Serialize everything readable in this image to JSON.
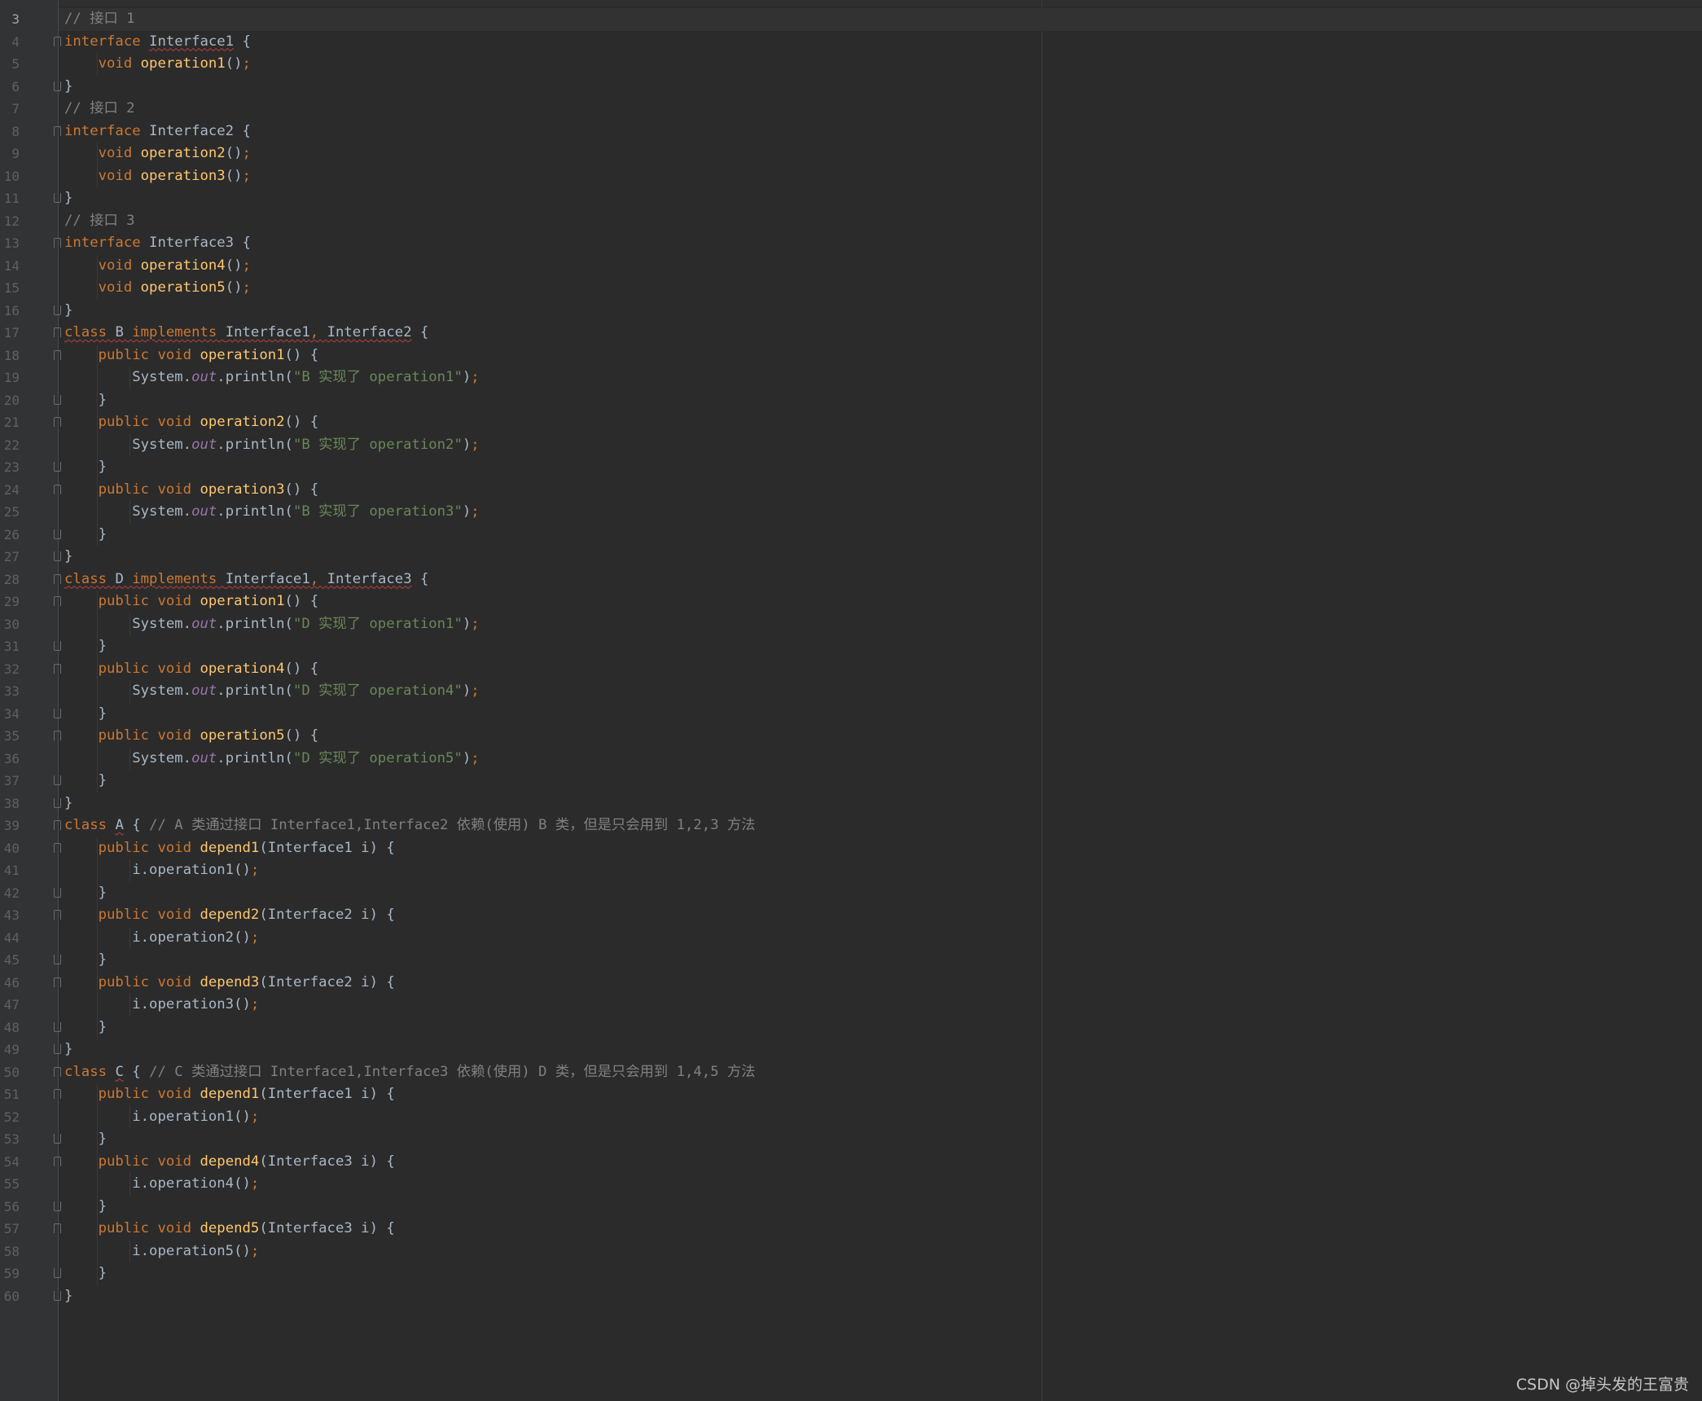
{
  "editor": {
    "language": "java",
    "current_line": "3",
    "colors": {
      "background": "#2b2b2b",
      "keyword": "#cc7832",
      "function": "#ffc66d",
      "comment": "#808080",
      "string": "#6a8759",
      "field": "#9876aa",
      "text": "#a9b7c6"
    },
    "lines": [
      {
        "n": "3",
        "fold": "",
        "indent": 0,
        "tokens": [
          [
            "cm",
            "// 接口 1"
          ]
        ]
      },
      {
        "n": "4",
        "fold": "open",
        "indent": 0,
        "tokens": [
          [
            "kw",
            "interface "
          ],
          [
            "wv",
            "Interface1"
          ],
          [
            "",
            " {"
          ]
        ]
      },
      {
        "n": "5",
        "fold": "",
        "indent": 1,
        "tokens": [
          [
            "kw",
            "void "
          ],
          [
            "fn",
            "operation1"
          ],
          [
            "",
            "()"
          ],
          [
            "kw",
            ";"
          ]
        ]
      },
      {
        "n": "6",
        "fold": "close",
        "indent": 0,
        "tokens": [
          [
            "",
            "}"
          ]
        ]
      },
      {
        "n": "7",
        "fold": "",
        "indent": 0,
        "tokens": [
          [
            "cm",
            "// 接口 2"
          ]
        ]
      },
      {
        "n": "8",
        "fold": "open",
        "indent": 0,
        "tokens": [
          [
            "kw",
            "interface "
          ],
          [
            "",
            "Interface2 {"
          ]
        ]
      },
      {
        "n": "9",
        "fold": "",
        "indent": 1,
        "tokens": [
          [
            "kw",
            "void "
          ],
          [
            "fn",
            "operation2"
          ],
          [
            "",
            "()"
          ],
          [
            "kw",
            ";"
          ]
        ]
      },
      {
        "n": "10",
        "fold": "",
        "indent": 1,
        "tokens": [
          [
            "kw",
            "void "
          ],
          [
            "fn",
            "operation3"
          ],
          [
            "",
            "()"
          ],
          [
            "kw",
            ";"
          ]
        ]
      },
      {
        "n": "11",
        "fold": "close",
        "indent": 0,
        "tokens": [
          [
            "",
            "}"
          ]
        ]
      },
      {
        "n": "12",
        "fold": "",
        "indent": 0,
        "tokens": [
          [
            "cm",
            "// 接口 3"
          ]
        ]
      },
      {
        "n": "13",
        "fold": "open",
        "indent": 0,
        "tokens": [
          [
            "kw",
            "interface "
          ],
          [
            "",
            "Interface3 {"
          ]
        ]
      },
      {
        "n": "14",
        "fold": "",
        "indent": 1,
        "tokens": [
          [
            "kw",
            "void "
          ],
          [
            "fn",
            "operation4"
          ],
          [
            "",
            "()"
          ],
          [
            "kw",
            ";"
          ]
        ]
      },
      {
        "n": "15",
        "fold": "",
        "indent": 1,
        "tokens": [
          [
            "kw",
            "void "
          ],
          [
            "fn",
            "operation5"
          ],
          [
            "",
            "()"
          ],
          [
            "kw",
            ";"
          ]
        ]
      },
      {
        "n": "16",
        "fold": "close",
        "indent": 0,
        "tokens": [
          [
            "",
            "}"
          ]
        ]
      },
      {
        "n": "17",
        "fold": "open",
        "indent": 0,
        "tokens": [
          [
            "kw wv",
            "class "
          ],
          [
            "wv",
            "B "
          ],
          [
            "kw wv",
            "implements "
          ],
          [
            "wv",
            "Interface1"
          ],
          [
            "kw wv",
            ", "
          ],
          [
            "wv",
            "Interface2"
          ],
          [
            "",
            " {"
          ]
        ]
      },
      {
        "n": "18",
        "fold": "open",
        "indent": 1,
        "tokens": [
          [
            "kw",
            "public void "
          ],
          [
            "fn",
            "operation1"
          ],
          [
            "",
            "() {"
          ]
        ]
      },
      {
        "n": "19",
        "fold": "",
        "indent": 2,
        "tokens": [
          [
            "",
            "System."
          ],
          [
            "fd",
            "out"
          ],
          [
            "",
            ".println("
          ],
          [
            "st",
            "\"B 实现了 operation1\""
          ],
          [
            "",
            ")"
          ],
          [
            "kw",
            ";"
          ]
        ]
      },
      {
        "n": "20",
        "fold": "close",
        "indent": 1,
        "tokens": [
          [
            "",
            "}"
          ]
        ]
      },
      {
        "n": "21",
        "fold": "open",
        "indent": 1,
        "tokens": [
          [
            "kw",
            "public void "
          ],
          [
            "fn",
            "operation2"
          ],
          [
            "",
            "() {"
          ]
        ]
      },
      {
        "n": "22",
        "fold": "",
        "indent": 2,
        "tokens": [
          [
            "",
            "System."
          ],
          [
            "fd",
            "out"
          ],
          [
            "",
            ".println("
          ],
          [
            "st",
            "\"B 实现了 operation2\""
          ],
          [
            "",
            ")"
          ],
          [
            "kw",
            ";"
          ]
        ]
      },
      {
        "n": "23",
        "fold": "close",
        "indent": 1,
        "tokens": [
          [
            "",
            "}"
          ]
        ]
      },
      {
        "n": "24",
        "fold": "open",
        "indent": 1,
        "tokens": [
          [
            "kw",
            "public void "
          ],
          [
            "fn",
            "operation3"
          ],
          [
            "",
            "() {"
          ]
        ]
      },
      {
        "n": "25",
        "fold": "",
        "indent": 2,
        "tokens": [
          [
            "",
            "System."
          ],
          [
            "fd",
            "out"
          ],
          [
            "",
            ".println("
          ],
          [
            "st",
            "\"B 实现了 operation3\""
          ],
          [
            "",
            ")"
          ],
          [
            "kw",
            ";"
          ]
        ]
      },
      {
        "n": "26",
        "fold": "close",
        "indent": 1,
        "tokens": [
          [
            "",
            "}"
          ]
        ]
      },
      {
        "n": "27",
        "fold": "close",
        "indent": 0,
        "tokens": [
          [
            "",
            "}"
          ]
        ]
      },
      {
        "n": "28",
        "fold": "open",
        "indent": 0,
        "tokens": [
          [
            "kw wv",
            "class "
          ],
          [
            "wv",
            "D "
          ],
          [
            "kw wv",
            "implements "
          ],
          [
            "wv",
            "Interface1"
          ],
          [
            "kw wv",
            ", "
          ],
          [
            "wv",
            "Interface3"
          ],
          [
            "",
            " {"
          ]
        ]
      },
      {
        "n": "29",
        "fold": "open",
        "indent": 1,
        "tokens": [
          [
            "kw",
            "public void "
          ],
          [
            "fn",
            "operation1"
          ],
          [
            "",
            "() {"
          ]
        ]
      },
      {
        "n": "30",
        "fold": "",
        "indent": 2,
        "tokens": [
          [
            "",
            "System."
          ],
          [
            "fd",
            "out"
          ],
          [
            "",
            ".println("
          ],
          [
            "st",
            "\"D 实现了 operation1\""
          ],
          [
            "",
            ")"
          ],
          [
            "kw",
            ";"
          ]
        ]
      },
      {
        "n": "31",
        "fold": "close",
        "indent": 1,
        "tokens": [
          [
            "",
            "}"
          ]
        ]
      },
      {
        "n": "32",
        "fold": "open",
        "indent": 1,
        "tokens": [
          [
            "kw",
            "public void "
          ],
          [
            "fn",
            "operation4"
          ],
          [
            "",
            "() {"
          ]
        ]
      },
      {
        "n": "33",
        "fold": "",
        "indent": 2,
        "tokens": [
          [
            "",
            "System."
          ],
          [
            "fd",
            "out"
          ],
          [
            "",
            ".println("
          ],
          [
            "st",
            "\"D 实现了 operation4\""
          ],
          [
            "",
            ")"
          ],
          [
            "kw",
            ";"
          ]
        ]
      },
      {
        "n": "34",
        "fold": "close",
        "indent": 1,
        "tokens": [
          [
            "",
            "}"
          ]
        ]
      },
      {
        "n": "35",
        "fold": "open",
        "indent": 1,
        "tokens": [
          [
            "kw",
            "public void "
          ],
          [
            "fn",
            "operation5"
          ],
          [
            "",
            "() {"
          ]
        ]
      },
      {
        "n": "36",
        "fold": "",
        "indent": 2,
        "tokens": [
          [
            "",
            "System."
          ],
          [
            "fd",
            "out"
          ],
          [
            "",
            ".println("
          ],
          [
            "st",
            "\"D 实现了 operation5\""
          ],
          [
            "",
            ")"
          ],
          [
            "kw",
            ";"
          ]
        ]
      },
      {
        "n": "37",
        "fold": "close",
        "indent": 1,
        "tokens": [
          [
            "",
            "}"
          ]
        ]
      },
      {
        "n": "38",
        "fold": "close",
        "indent": 0,
        "tokens": [
          [
            "",
            "}"
          ]
        ]
      },
      {
        "n": "39",
        "fold": "open",
        "indent": 0,
        "tokens": [
          [
            "kw",
            "class "
          ],
          [
            "wv",
            "A"
          ],
          [
            "",
            " { "
          ],
          [
            "cm",
            "// A 类通过接口 Interface1,Interface2 依赖(使用) B 类，但是只会用到 1,2,3 方法"
          ]
        ]
      },
      {
        "n": "40",
        "fold": "open",
        "indent": 1,
        "tokens": [
          [
            "kw",
            "public void "
          ],
          [
            "fn",
            "depend1"
          ],
          [
            "",
            "(Interface1 i) {"
          ]
        ]
      },
      {
        "n": "41",
        "fold": "",
        "indent": 2,
        "tokens": [
          [
            "",
            "i.operation1()"
          ],
          [
            "kw",
            ";"
          ]
        ]
      },
      {
        "n": "42",
        "fold": "close",
        "indent": 1,
        "tokens": [
          [
            "",
            "}"
          ]
        ]
      },
      {
        "n": "43",
        "fold": "open",
        "indent": 1,
        "tokens": [
          [
            "kw",
            "public void "
          ],
          [
            "fn",
            "depend2"
          ],
          [
            "",
            "(Interface2 i) {"
          ]
        ]
      },
      {
        "n": "44",
        "fold": "",
        "indent": 2,
        "tokens": [
          [
            "",
            "i.operation2()"
          ],
          [
            "kw",
            ";"
          ]
        ]
      },
      {
        "n": "45",
        "fold": "close",
        "indent": 1,
        "tokens": [
          [
            "",
            "}"
          ]
        ]
      },
      {
        "n": "46",
        "fold": "open",
        "indent": 1,
        "tokens": [
          [
            "kw",
            "public void "
          ],
          [
            "fn",
            "depend3"
          ],
          [
            "",
            "(Interface2 i) {"
          ]
        ]
      },
      {
        "n": "47",
        "fold": "",
        "indent": 2,
        "tokens": [
          [
            "",
            "i.operation3()"
          ],
          [
            "kw",
            ";"
          ]
        ]
      },
      {
        "n": "48",
        "fold": "close",
        "indent": 1,
        "tokens": [
          [
            "",
            "}"
          ]
        ]
      },
      {
        "n": "49",
        "fold": "close",
        "indent": 0,
        "tokens": [
          [
            "",
            "}"
          ]
        ]
      },
      {
        "n": "50",
        "fold": "open",
        "indent": 0,
        "tokens": [
          [
            "kw",
            "class "
          ],
          [
            "wv",
            "C"
          ],
          [
            "",
            " { "
          ],
          [
            "cm",
            "// C 类通过接口 Interface1,Interface3 依赖(使用) D 类，但是只会用到 1,4,5 方法"
          ]
        ]
      },
      {
        "n": "51",
        "fold": "open",
        "indent": 1,
        "tokens": [
          [
            "kw",
            "public void "
          ],
          [
            "fn",
            "depend1"
          ],
          [
            "",
            "(Interface1 i) {"
          ]
        ]
      },
      {
        "n": "52",
        "fold": "",
        "indent": 2,
        "tokens": [
          [
            "",
            "i.operation1()"
          ],
          [
            "kw",
            ";"
          ]
        ]
      },
      {
        "n": "53",
        "fold": "close",
        "indent": 1,
        "tokens": [
          [
            "",
            "}"
          ]
        ]
      },
      {
        "n": "54",
        "fold": "open",
        "indent": 1,
        "tokens": [
          [
            "kw",
            "public void "
          ],
          [
            "fn",
            "depend4"
          ],
          [
            "",
            "(Interface3 i) {"
          ]
        ]
      },
      {
        "n": "55",
        "fold": "",
        "indent": 2,
        "tokens": [
          [
            "",
            "i.operation4()"
          ],
          [
            "kw",
            ";"
          ]
        ]
      },
      {
        "n": "56",
        "fold": "close",
        "indent": 1,
        "tokens": [
          [
            "",
            "}"
          ]
        ]
      },
      {
        "n": "57",
        "fold": "open",
        "indent": 1,
        "tokens": [
          [
            "kw",
            "public void "
          ],
          [
            "fn",
            "depend5"
          ],
          [
            "",
            "(Interface3 i) {"
          ]
        ]
      },
      {
        "n": "58",
        "fold": "",
        "indent": 2,
        "tokens": [
          [
            "",
            "i.operation5()"
          ],
          [
            "kw",
            ";"
          ]
        ]
      },
      {
        "n": "59",
        "fold": "close",
        "indent": 1,
        "tokens": [
          [
            "",
            "}"
          ]
        ]
      },
      {
        "n": "60",
        "fold": "close",
        "indent": 0,
        "tokens": [
          [
            "",
            "}"
          ]
        ]
      }
    ]
  },
  "watermark": {
    "text": "CSDN @掉头发的王富贵"
  }
}
